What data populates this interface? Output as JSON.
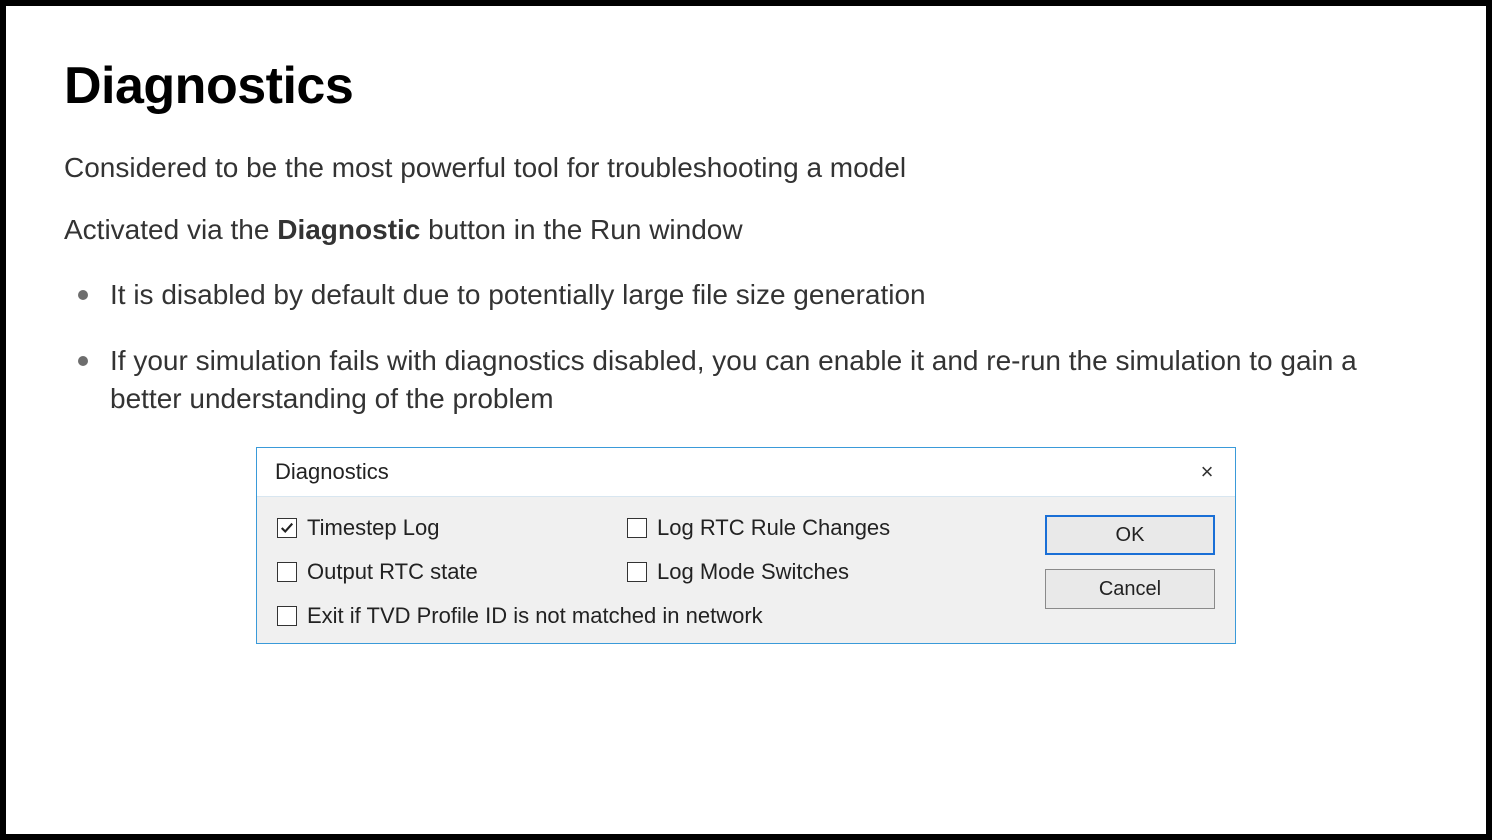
{
  "slide": {
    "title": "Diagnostics",
    "intro1": "Considered to be the most powerful tool for troubleshooting a model",
    "intro2_pre": "Activated via the ",
    "intro2_bold": "Diagnostic",
    "intro2_post": " button in the Run window",
    "bullets": [
      "It is disabled by default due to potentially large file size generation",
      "If your simulation fails with diagnostics disabled, you can enable it and re-run the simulation to gain a better understanding of the problem"
    ]
  },
  "dialog": {
    "title": "Diagnostics",
    "close": "×",
    "checkboxes": {
      "timestep_log": {
        "label": "Timestep Log",
        "checked": true
      },
      "output_rtc": {
        "label": "Output RTC state",
        "checked": false
      },
      "log_rtc_rule": {
        "label": "Log RTC Rule Changes",
        "checked": false
      },
      "log_mode": {
        "label": "Log Mode Switches",
        "checked": false
      },
      "exit_tvd": {
        "label": "Exit if TVD Profile ID is not matched in network",
        "checked": false
      }
    },
    "buttons": {
      "ok": "OK",
      "cancel": "Cancel"
    }
  }
}
